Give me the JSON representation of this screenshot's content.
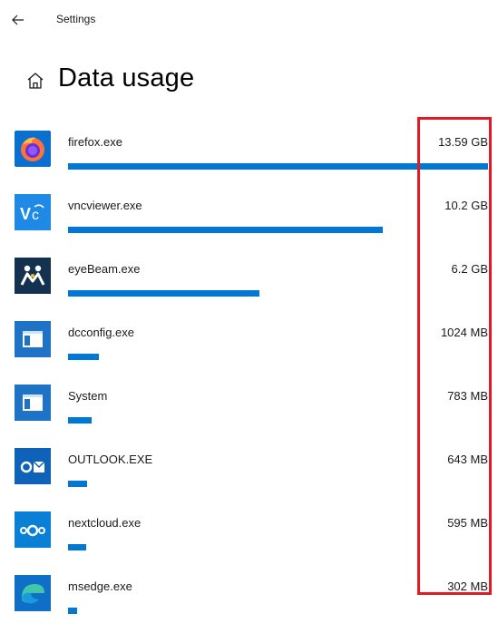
{
  "window": {
    "title": "Settings"
  },
  "page": {
    "title": "Data usage"
  },
  "apps": [
    {
      "name": "firefox.exe",
      "usage": "13.59 GB",
      "fraction": 1.0,
      "icon": "firefox-icon"
    },
    {
      "name": "vncviewer.exe",
      "usage": "10.2 GB",
      "fraction": 0.75,
      "icon": "vncviewer-icon"
    },
    {
      "name": "eyeBeam.exe",
      "usage": "6.2 GB",
      "fraction": 0.456,
      "icon": "eyebeam-icon"
    },
    {
      "name": "dcconfig.exe",
      "usage": "1024 MB",
      "fraction": 0.074,
      "icon": "window-app-icon"
    },
    {
      "name": "System",
      "usage": "783 MB",
      "fraction": 0.056,
      "icon": "window-app-icon"
    },
    {
      "name": "OUTLOOK.EXE",
      "usage": "643 MB",
      "fraction": 0.046,
      "icon": "outlook-icon"
    },
    {
      "name": "nextcloud.exe",
      "usage": "595 MB",
      "fraction": 0.043,
      "icon": "nextcloud-icon"
    },
    {
      "name": "msedge.exe",
      "usage": "302 MB",
      "fraction": 0.022,
      "icon": "edge-icon"
    }
  ],
  "colors": {
    "accent": "#0078d4",
    "highlight": "#e01b24"
  }
}
